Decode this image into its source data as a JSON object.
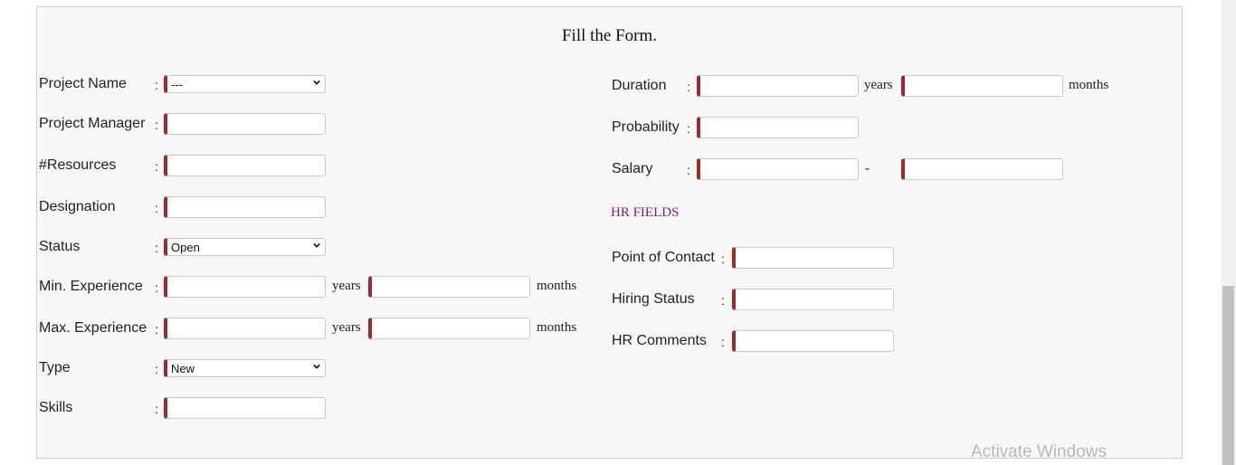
{
  "form": {
    "title": "Fill the Form.",
    "colon": ":",
    "left": {
      "project_name": {
        "label": "Project Name",
        "value": "---"
      },
      "project_manager": {
        "label": "Project Manager",
        "value": ""
      },
      "resources": {
        "label": "#Resources",
        "value": ""
      },
      "designation": {
        "label": "Designation",
        "value": ""
      },
      "status": {
        "label": "Status",
        "value": "Open"
      },
      "min_experience": {
        "label": "Min. Experience",
        "years_value": "",
        "months_value": ""
      },
      "max_experience": {
        "label": "Max. Experience",
        "years_value": "",
        "months_value": ""
      },
      "type": {
        "label": "Type",
        "value": "New"
      },
      "skills": {
        "label": "Skills",
        "value": ""
      }
    },
    "right": {
      "duration": {
        "label": "Duration",
        "years_value": "",
        "months_value": ""
      },
      "probability": {
        "label": "Probability",
        "value": ""
      },
      "salary": {
        "label": "Salary",
        "min_value": "",
        "max_value": "",
        "separator": "-"
      },
      "hr_section_title": "HR FIELDS",
      "point_of_contact": {
        "label": "Point of Contact",
        "value": ""
      },
      "hiring_status": {
        "label": "Hiring Status",
        "value": ""
      },
      "hr_comments": {
        "label": "HR Comments",
        "value": ""
      }
    },
    "units": {
      "years": "years",
      "months": "months"
    }
  },
  "watermark": "Activate Windows",
  "colors": {
    "panel_bg": "#f7f7f7",
    "panel_border": "#b8d4e3",
    "required_accent": "#9e2a2b",
    "section_title": "#7a1f7a"
  }
}
